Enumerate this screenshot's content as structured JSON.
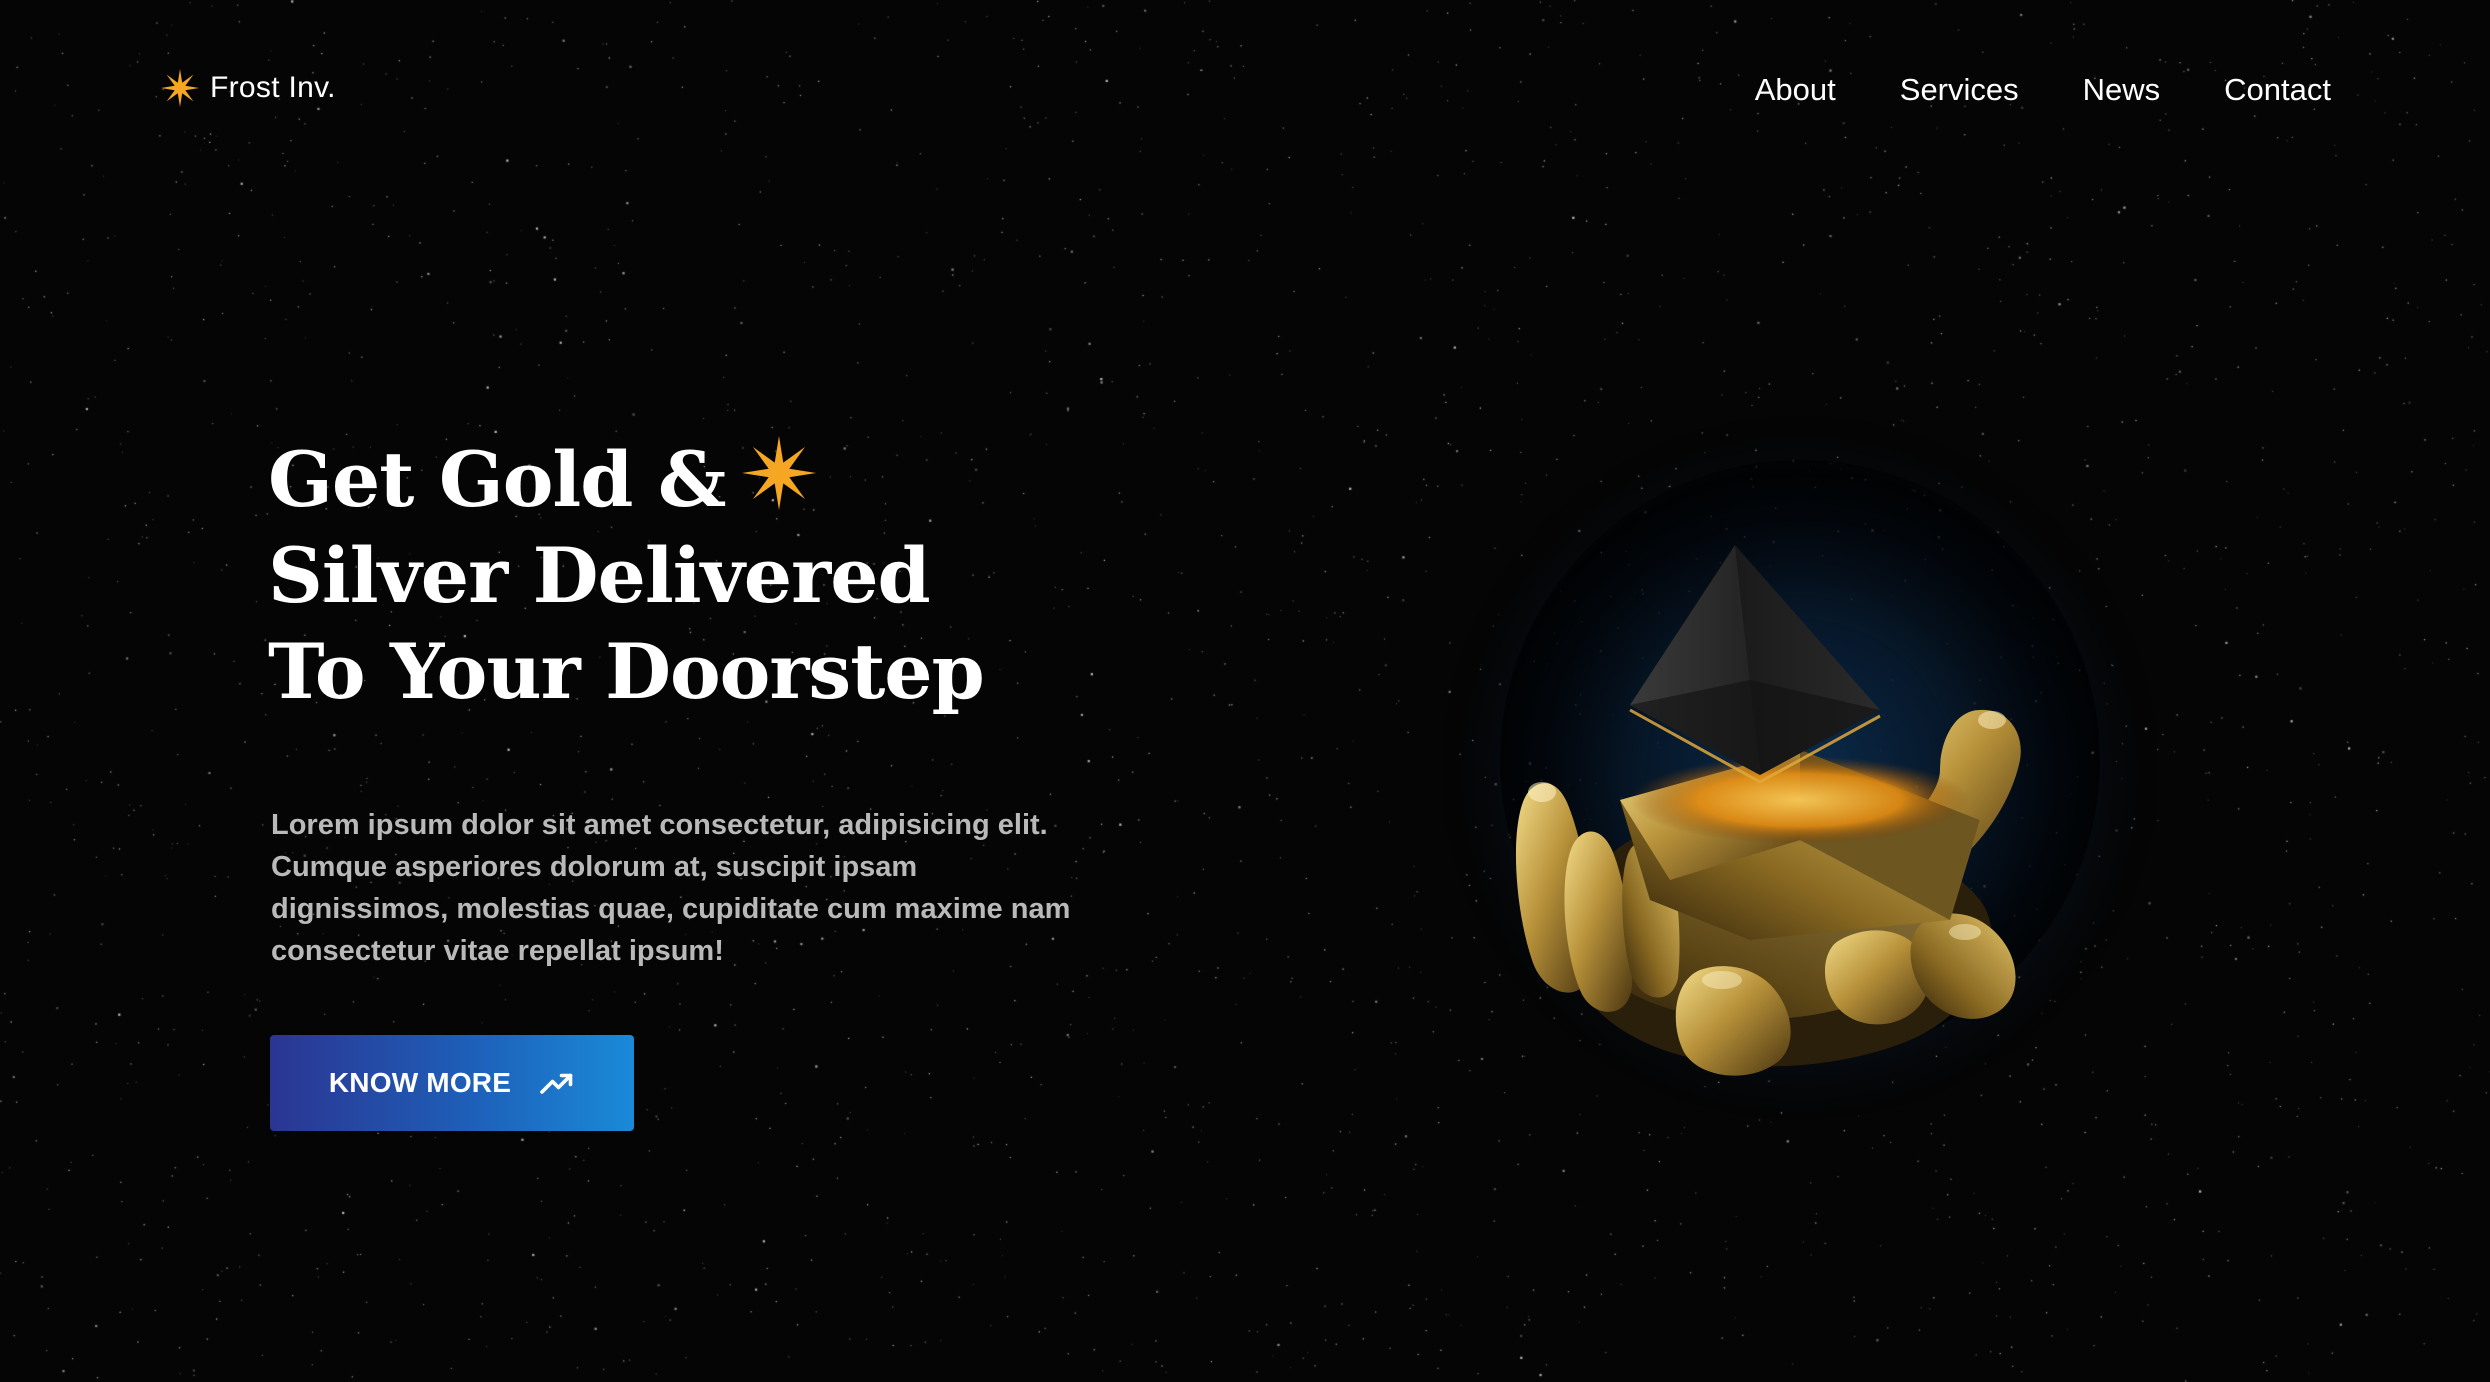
{
  "brand": {
    "name": "Frost Inv.",
    "icon": "star-burst-icon",
    "accent_color": "#F5A623"
  },
  "nav": {
    "items": [
      {
        "label": "About"
      },
      {
        "label": "Services"
      },
      {
        "label": "News"
      },
      {
        "label": "Contact"
      }
    ]
  },
  "hero": {
    "title_lines": [
      "Get Gold &",
      "Silver Delivered",
      "To Your Doorstep"
    ],
    "description": "Lorem ipsum dolor sit amet consectetur, adipisicing elit. Cumque asperiores dolorum at, suscipit ipsam dignissimos, molestias quae, cupiditate cum maxime nam consectetur vitae repellat ipsum!",
    "cta_label": "KNOW MORE",
    "cta_icon": "trending-up-icon",
    "illustration": "golden-hand-holding-pyramid"
  },
  "colors": {
    "background": "#050505",
    "text": "#FFFFFF",
    "muted_text": "#B9B9B9",
    "button_gradient_start": "#2B3592",
    "button_gradient_end": "#1A8AD8",
    "glow": "#1E6FC0",
    "gold": "#C9A54A"
  }
}
